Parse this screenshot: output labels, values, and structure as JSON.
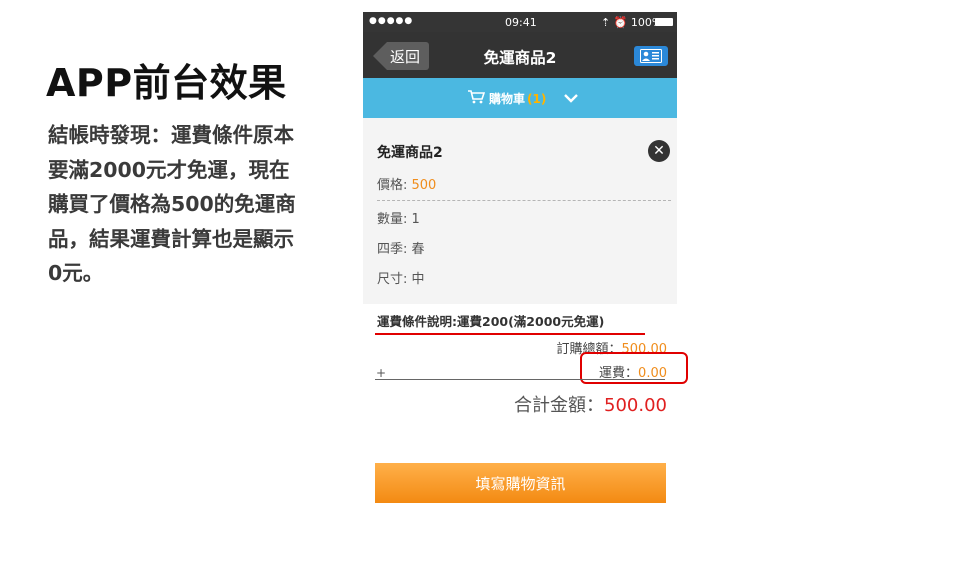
{
  "slide": {
    "title": "APP前台效果",
    "description": "結帳時發現：運費條件原本要滿2000元才免運，現在購買了價格為500的免運商品，結果運費計算也是顯示0元。"
  },
  "statusbar": {
    "signal": "●●●●● ",
    "time": "09:41",
    "battery": "⇡ ⏰ 100%"
  },
  "navbar": {
    "back_label": "返回",
    "title": "免運商品2",
    "contact_icon": "contact-card-icon"
  },
  "cart": {
    "label": "購物車",
    "count": "(1)",
    "icon": "cart-icon",
    "toggle_icon": "chevron-down-icon"
  },
  "item": {
    "name": "免運商品2",
    "price_label": "價格: ",
    "price": "500",
    "qty": "數量: 1",
    "season": "四季: 春",
    "size": "尺寸: 中"
  },
  "summary": {
    "shipping_note": "運費條件說明:運費200(滿2000元免運)",
    "order_total_label": "訂購總額：",
    "order_total": "500.00",
    "plus": "+",
    "shipping_label": "運費：",
    "shipping": "0.00",
    "grand_label": "合計金額：",
    "grand_total": "500.00"
  },
  "checkout_label": "填寫購物資訊",
  "colors": {
    "accent_blue": "#4bb8e1",
    "orange": "#f38a12",
    "highlight_red": "#e00000"
  }
}
